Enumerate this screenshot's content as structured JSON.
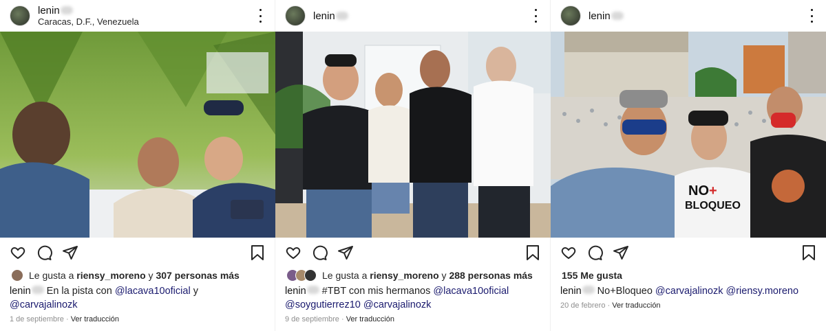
{
  "posts": [
    {
      "username": "lenin",
      "location": "Caracas, D.F., Venezuela",
      "likes_prefix": "Le gusta a",
      "likes_user": "riensy_moreno",
      "likes_connector": "y",
      "likes_count": "307 personas más",
      "caption_user": "lenin",
      "caption_text": "En la pista con",
      "caption_tag1": "@lacava10oficial",
      "caption_mid": "y",
      "caption_tag2": "@carvajalinozk",
      "date": "1 de septiembre",
      "translate": "Ver traducción"
    },
    {
      "username": "lenin",
      "location": "",
      "likes_prefix": "Le gusta a",
      "likes_user": "riensy_moreno",
      "likes_connector": "y",
      "likes_count": "288 personas más",
      "caption_user": "lenin",
      "caption_text": "#TBT con mis hermanos",
      "caption_tag1": "@lacava10oficial",
      "caption_tag2": "@soygutierrez10",
      "caption_tag3": "@carvajalinozk",
      "date": "9 de septiembre",
      "translate": "Ver traducción"
    },
    {
      "username": "lenin",
      "location": "",
      "likes_total": "155 Me gusta",
      "caption_user": "lenin",
      "caption_text": "No+Bloqueo",
      "caption_tag1": "@carvajalinozk",
      "caption_tag2": "@riensy.moreno",
      "date": "20 de febrero",
      "translate": "Ver traducción",
      "shirt_text1": "NO",
      "shirt_text2": "+",
      "shirt_text3": "BLOQUEO"
    }
  ],
  "separator": "·",
  "colors": {
    "icon": "#262626",
    "meta": "#8e8e8e",
    "tag": "#1a1a6e"
  }
}
